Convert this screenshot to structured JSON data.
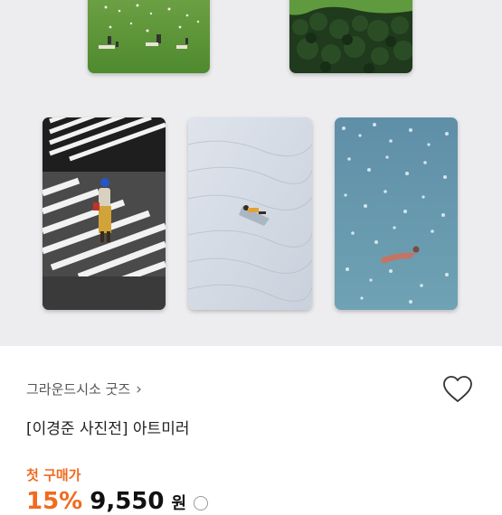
{
  "product": {
    "brand": "그라운드시소 굿즈",
    "brand_chevron": "›",
    "title": "[이경준 사진전] 아트미러",
    "first_purchase_label": "첫 구매가",
    "discount": "15%",
    "price": "9,550",
    "currency": "원"
  },
  "gallery": {
    "cards": [
      {
        "scene": "park-lawn"
      },
      {
        "scene": "forest-aerial"
      },
      {
        "scene": "crosswalk"
      },
      {
        "scene": "snow-figure"
      },
      {
        "scene": "sparkling-water-swimmer"
      }
    ]
  },
  "colors": {
    "accent": "#f06a1f",
    "gallery_bg": "#ededf0"
  },
  "icons": {
    "wishlist": "heart-outline-icon",
    "brand_link": "chevron-right-icon",
    "price_info": "info-icon"
  }
}
